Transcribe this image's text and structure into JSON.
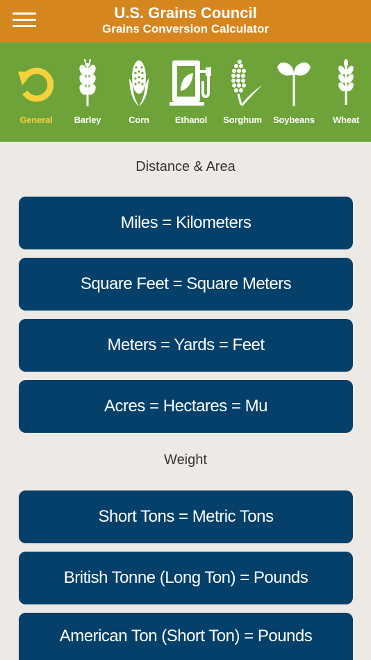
{
  "header": {
    "title": "U.S. Grains Council",
    "subtitle": "Grains Conversion Calculator"
  },
  "nav": {
    "items": [
      {
        "label": "General",
        "icon": "refresh-arrow-icon",
        "active": true
      },
      {
        "label": "Barley",
        "icon": "barley-icon"
      },
      {
        "label": "Corn",
        "icon": "corn-icon"
      },
      {
        "label": "Ethanol",
        "icon": "fuel-pump-icon"
      },
      {
        "label": "Sorghum",
        "icon": "sorghum-icon"
      },
      {
        "label": "Soybeans",
        "icon": "soybean-sprout-icon"
      },
      {
        "label": "Wheat",
        "icon": "wheat-icon"
      }
    ]
  },
  "sections": [
    {
      "title": "Distance & Area",
      "buttons": [
        "Miles = Kilometers",
        "Square Feet = Square Meters",
        "Meters = Yards = Feet",
        "Acres = Hectares = Mu"
      ]
    },
    {
      "title": "Weight",
      "buttons": [
        "Short Tons = Metric Tons",
        "British Tonne (Long Ton) = Pounds",
        "American Ton (Short Ton) = Pounds"
      ]
    }
  ],
  "colors": {
    "header_bg": "#d6861f",
    "nav_bg": "#6ea33a",
    "active_label": "#f3d23e",
    "button_bg": "#04406a",
    "page_bg": "#ede9e4"
  }
}
